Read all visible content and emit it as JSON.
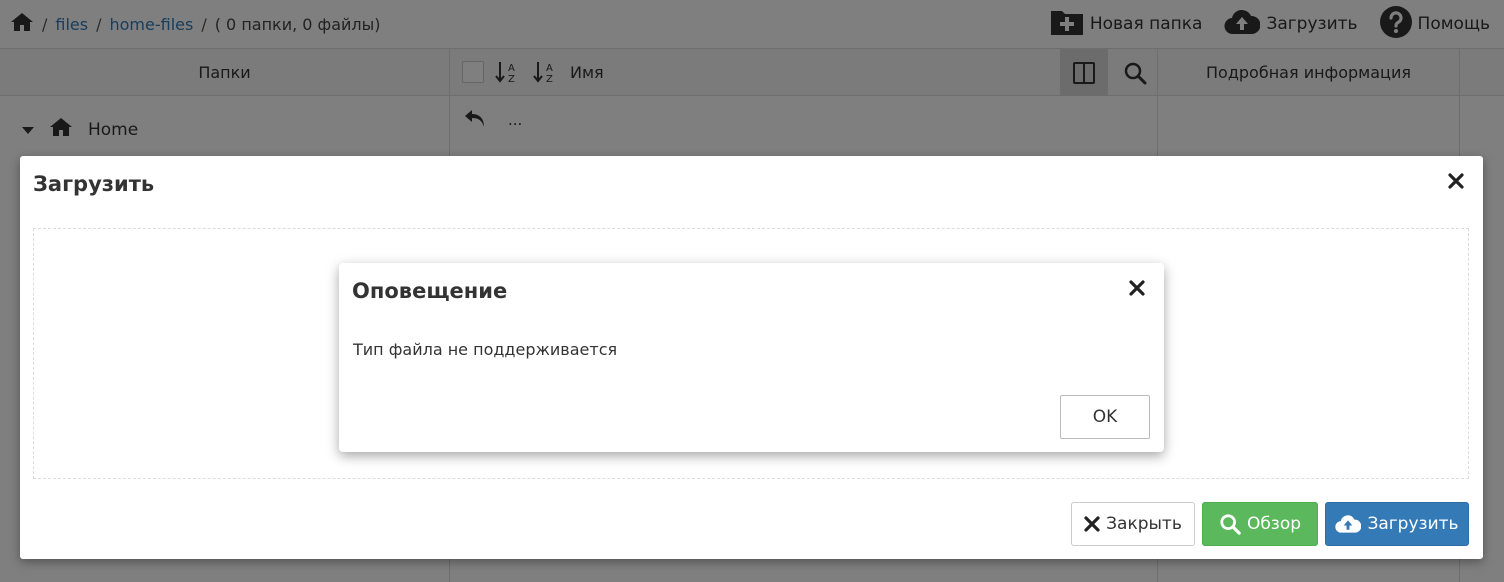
{
  "breadcrumb": {
    "sep": "/",
    "items": [
      "files",
      "home-files"
    ],
    "count": "( 0 папки, 0 файлы)"
  },
  "toolbar": {
    "new_folder": "Новая папка",
    "upload": "Загрузить",
    "help": "Помощь"
  },
  "columns": {
    "folders": "Папки",
    "name": "Имя",
    "details": "Подробная информация"
  },
  "tree": {
    "home": "Home"
  },
  "files": {
    "parent": "..."
  },
  "upload_modal": {
    "title": "Загрузить",
    "close_label": "Закрыть",
    "browse_label": "Обзор",
    "upload_label": "Загрузить"
  },
  "alert": {
    "title": "Оповещение",
    "message": "Тип файла не поддерживается",
    "ok_label": "OK"
  },
  "colors": {
    "link": "#337ab7",
    "browse": "#5cb85c",
    "upload": "#337ab7"
  }
}
